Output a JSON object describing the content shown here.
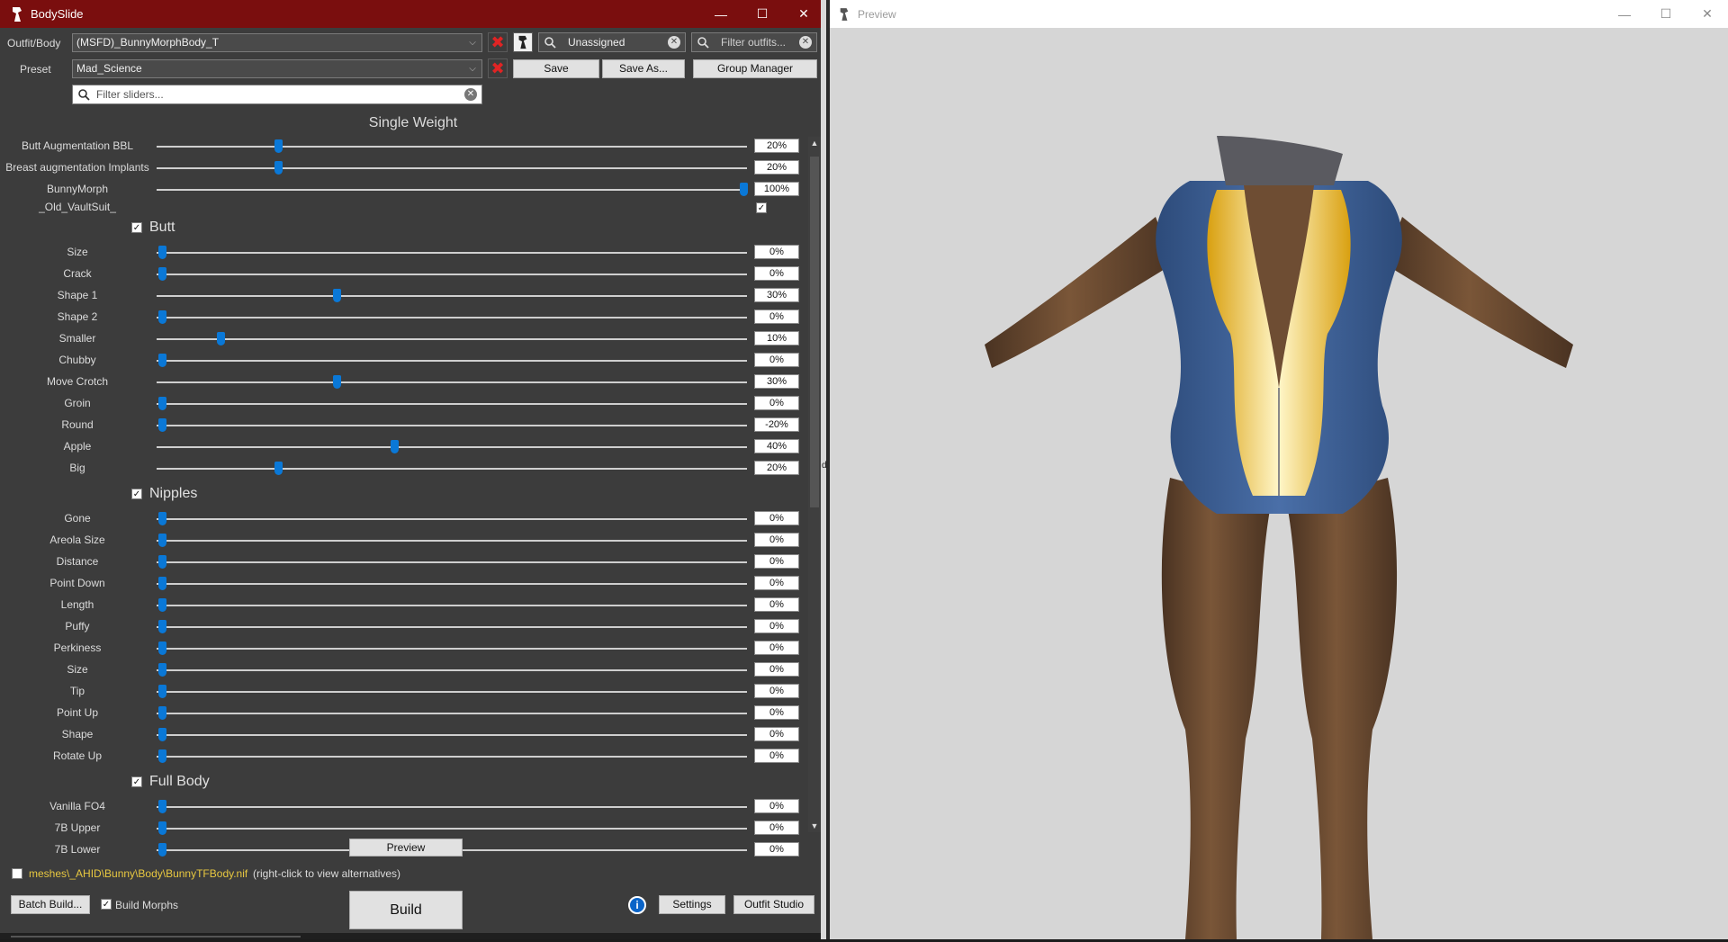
{
  "bodyslide": {
    "window_title": "BodySlide",
    "outfit_label": "Outfit/Body",
    "outfit_value": "(MSFD)_BunnyMorphBody_T",
    "group_filter_value": "Unassigned",
    "outfit_filter_placeholder": "Filter outfits...",
    "preset_label": "Preset",
    "preset_value": "Mad_Science",
    "save_label": "Save",
    "save_as_label": "Save As...",
    "group_manager_label": "Group Manager",
    "slider_filter_placeholder": "Filter sliders...",
    "weight_header": "Single Weight",
    "top_sliders": [
      {
        "name": "Butt Augmentation BBL",
        "value": "20%",
        "level": 20
      },
      {
        "name": "Breast augmentation Implants",
        "value": "20%",
        "level": 20
      },
      {
        "name": "BunnyMorph",
        "value": "100%",
        "level": 100
      }
    ],
    "zap_slider": {
      "name": "_Old_VaultSuit_",
      "checked": true
    },
    "groups": [
      {
        "name": "Butt",
        "sliders": [
          {
            "name": "Size",
            "value": "0%",
            "level": 0
          },
          {
            "name": "Crack",
            "value": "0%",
            "level": 0
          },
          {
            "name": "Shape 1",
            "value": "30%",
            "level": 30
          },
          {
            "name": "Shape 2",
            "value": "0%",
            "level": 0
          },
          {
            "name": "Smaller",
            "value": "10%",
            "level": 10
          },
          {
            "name": "Chubby",
            "value": "0%",
            "level": 0
          },
          {
            "name": "Move Crotch",
            "value": "30%",
            "level": 30
          },
          {
            "name": "Groin",
            "value": "0%",
            "level": 0
          },
          {
            "name": "Round",
            "value": "-20%",
            "level": 0
          },
          {
            "name": "Apple",
            "value": "40%",
            "level": 40
          },
          {
            "name": "Big",
            "value": "20%",
            "level": 20
          }
        ]
      },
      {
        "name": "Nipples",
        "sliders": [
          {
            "name": "Gone",
            "value": "0%",
            "level": 0
          },
          {
            "name": "Areola Size",
            "value": "0%",
            "level": 0
          },
          {
            "name": "Distance",
            "value": "0%",
            "level": 0
          },
          {
            "name": "Point Down",
            "value": "0%",
            "level": 0
          },
          {
            "name": "Length",
            "value": "0%",
            "level": 0
          },
          {
            "name": "Puffy",
            "value": "0%",
            "level": 0
          },
          {
            "name": "Perkiness",
            "value": "0%",
            "level": 0
          },
          {
            "name": "Size",
            "value": "0%",
            "level": 0
          },
          {
            "name": "Tip",
            "value": "0%",
            "level": 0
          },
          {
            "name": "Point Up",
            "value": "0%",
            "level": 0
          },
          {
            "name": "Shape",
            "value": "0%",
            "level": 0
          },
          {
            "name": "Rotate Up",
            "value": "0%",
            "level": 0
          }
        ]
      },
      {
        "name": "Full Body",
        "sliders": [
          {
            "name": "Vanilla FO4",
            "value": "0%",
            "level": 0
          },
          {
            "name": "7B Upper",
            "value": "0%",
            "level": 0
          },
          {
            "name": "7B Lower",
            "value": "0%",
            "level": 0
          }
        ]
      }
    ],
    "preview_button": "Preview",
    "output_path": "meshes\\_AHID\\Bunny\\Body\\BunnyTFBody.nif",
    "output_hint": "(right-click to view alternatives)",
    "batch_build_label": "Batch Build...",
    "build_morphs_label": "Build Morphs",
    "build_label": "Build",
    "settings_label": "Settings",
    "outfit_studio_label": "Outfit Studio",
    "colors": {
      "titlebar": "#7a0e0e",
      "accent": "#0a78d7",
      "path": "#e8c840"
    }
  },
  "preview": {
    "window_title": "Preview",
    "edge_letter": "d"
  }
}
